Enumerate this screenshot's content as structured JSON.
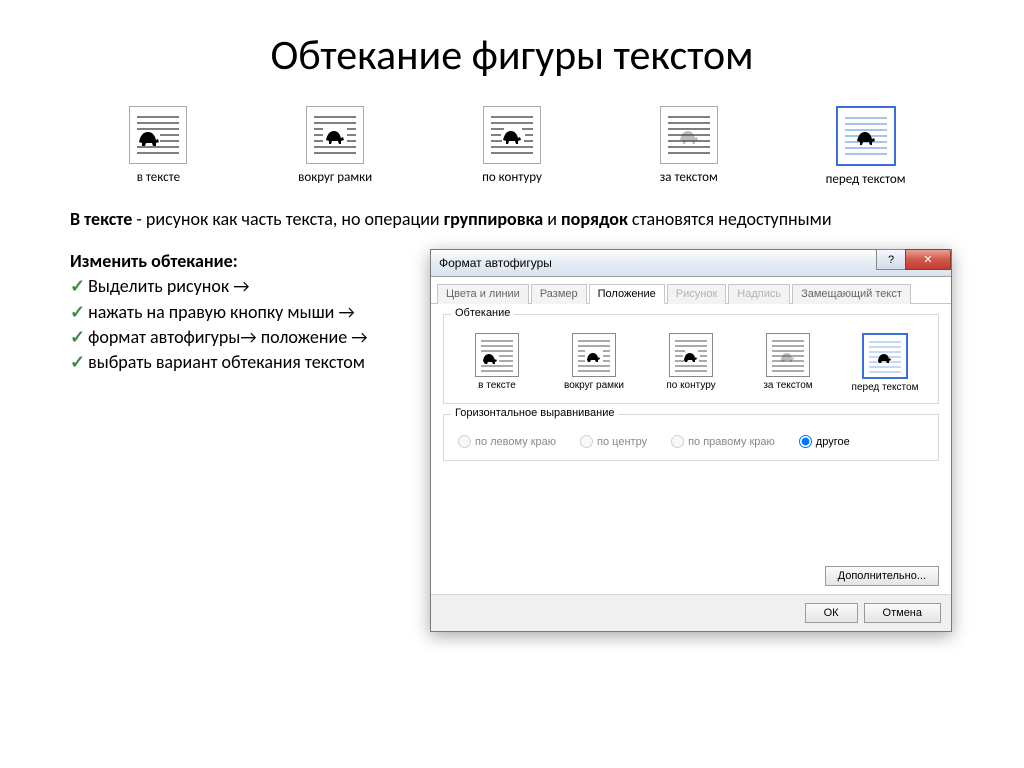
{
  "title": "Обтекание фигуры текстом",
  "wrap_options": {
    "inline": "в тексте",
    "square": "вокруг рамки",
    "tight": "по контуру",
    "behind": "за текстом",
    "front": "перед текстом"
  },
  "desc": {
    "lead": "В тексте",
    "mid": " - рисунок как часть текста, но операции ",
    "grp": "группировка",
    "and": " и ",
    "ord": "порядок",
    "tail": " становятся недоступными"
  },
  "instr": {
    "heading": "Изменить обтекание:",
    "s1": "Выделить рисунок →",
    "s2": "нажать на правую кнопку мыши →",
    "s3": "формат автофигуры→ положение →",
    "s4": "выбрать вариант обтекания текстом"
  },
  "dialog": {
    "title": "Формат автофигуры",
    "tabs": {
      "colors": "Цвета и линии",
      "size": "Размер",
      "position": "Положение",
      "picture": "Рисунок",
      "textbox": "Надпись",
      "alttext": "Замещающий текст"
    },
    "group_wrap": "Обтекание",
    "group_align": "Горизонтальное выравнивание",
    "align": {
      "left": "по левому краю",
      "center": "по центру",
      "right": "по правому краю",
      "other": "другое"
    },
    "advanced": "Дополнительно...",
    "ok": "ОК",
    "cancel": "Отмена"
  }
}
